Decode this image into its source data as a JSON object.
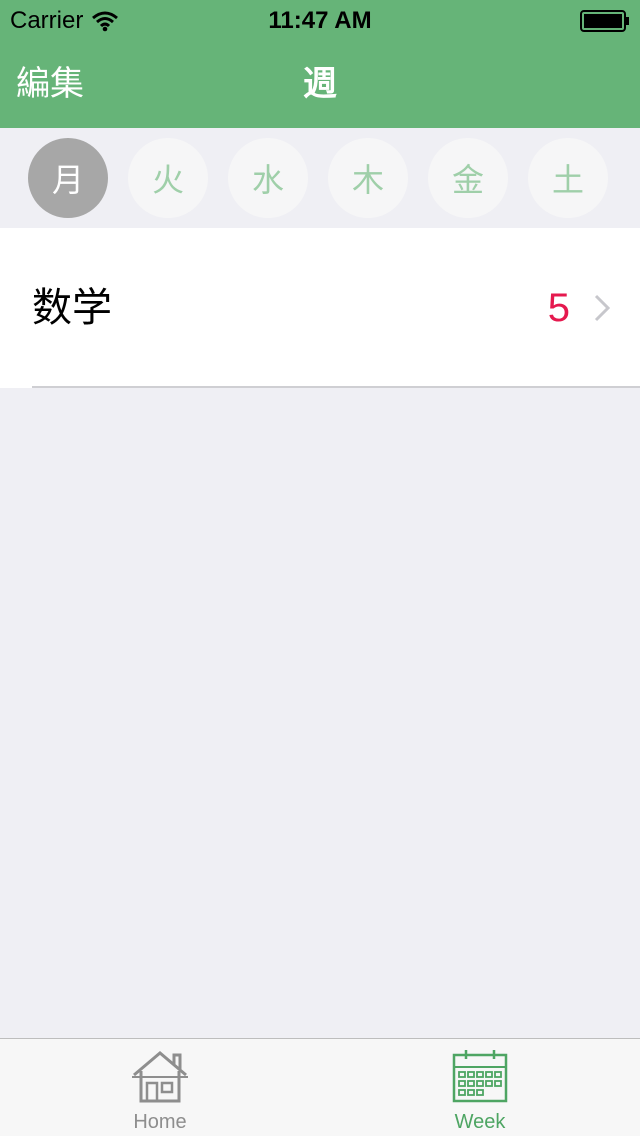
{
  "status_bar": {
    "carrier": "Carrier",
    "time": "11:47 AM",
    "icons": [
      "wifi-icon",
      "battery-icon"
    ]
  },
  "nav": {
    "edit_label": "編集",
    "title": "週"
  },
  "days": [
    {
      "label": "月",
      "selected": true
    },
    {
      "label": "火",
      "selected": false
    },
    {
      "label": "水",
      "selected": false
    },
    {
      "label": "木",
      "selected": false
    },
    {
      "label": "金",
      "selected": false
    },
    {
      "label": "土",
      "selected": false
    }
  ],
  "list": {
    "items": [
      {
        "title": "数学",
        "count": "5"
      }
    ]
  },
  "tabbar": {
    "tabs": [
      {
        "label": "Home",
        "icon": "home-icon",
        "active": false
      },
      {
        "label": "Week",
        "icon": "calendar-icon",
        "active": true
      }
    ]
  },
  "colors": {
    "nav_background": "#66b478",
    "accent_green": "#4ea563",
    "badge_red": "#e5194e",
    "selected_day": "#a7a7a7"
  }
}
